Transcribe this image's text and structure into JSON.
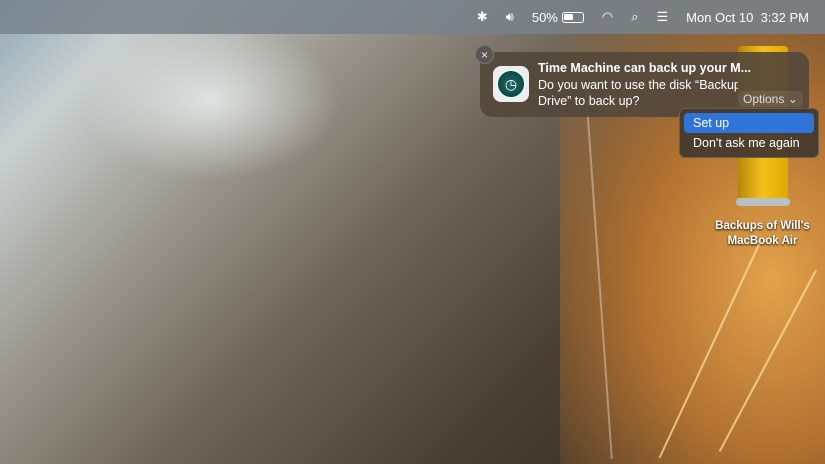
{
  "menubar": {
    "battery": "50%",
    "datetime": "Mon Oct 10  3:32 PM"
  },
  "notification": {
    "title": "Time Machine can back up your M...",
    "body_line1": "Do you want to use the disk “Backup",
    "body_line2": "Drive” to back up?",
    "options_label": "Options ⌄",
    "close": "×"
  },
  "menu": {
    "items": [
      "Set up",
      "Don't ask me again"
    ]
  },
  "desktop": {
    "drive_label_1": "Backups of Will's",
    "drive_label_2": "MacBook Air"
  }
}
